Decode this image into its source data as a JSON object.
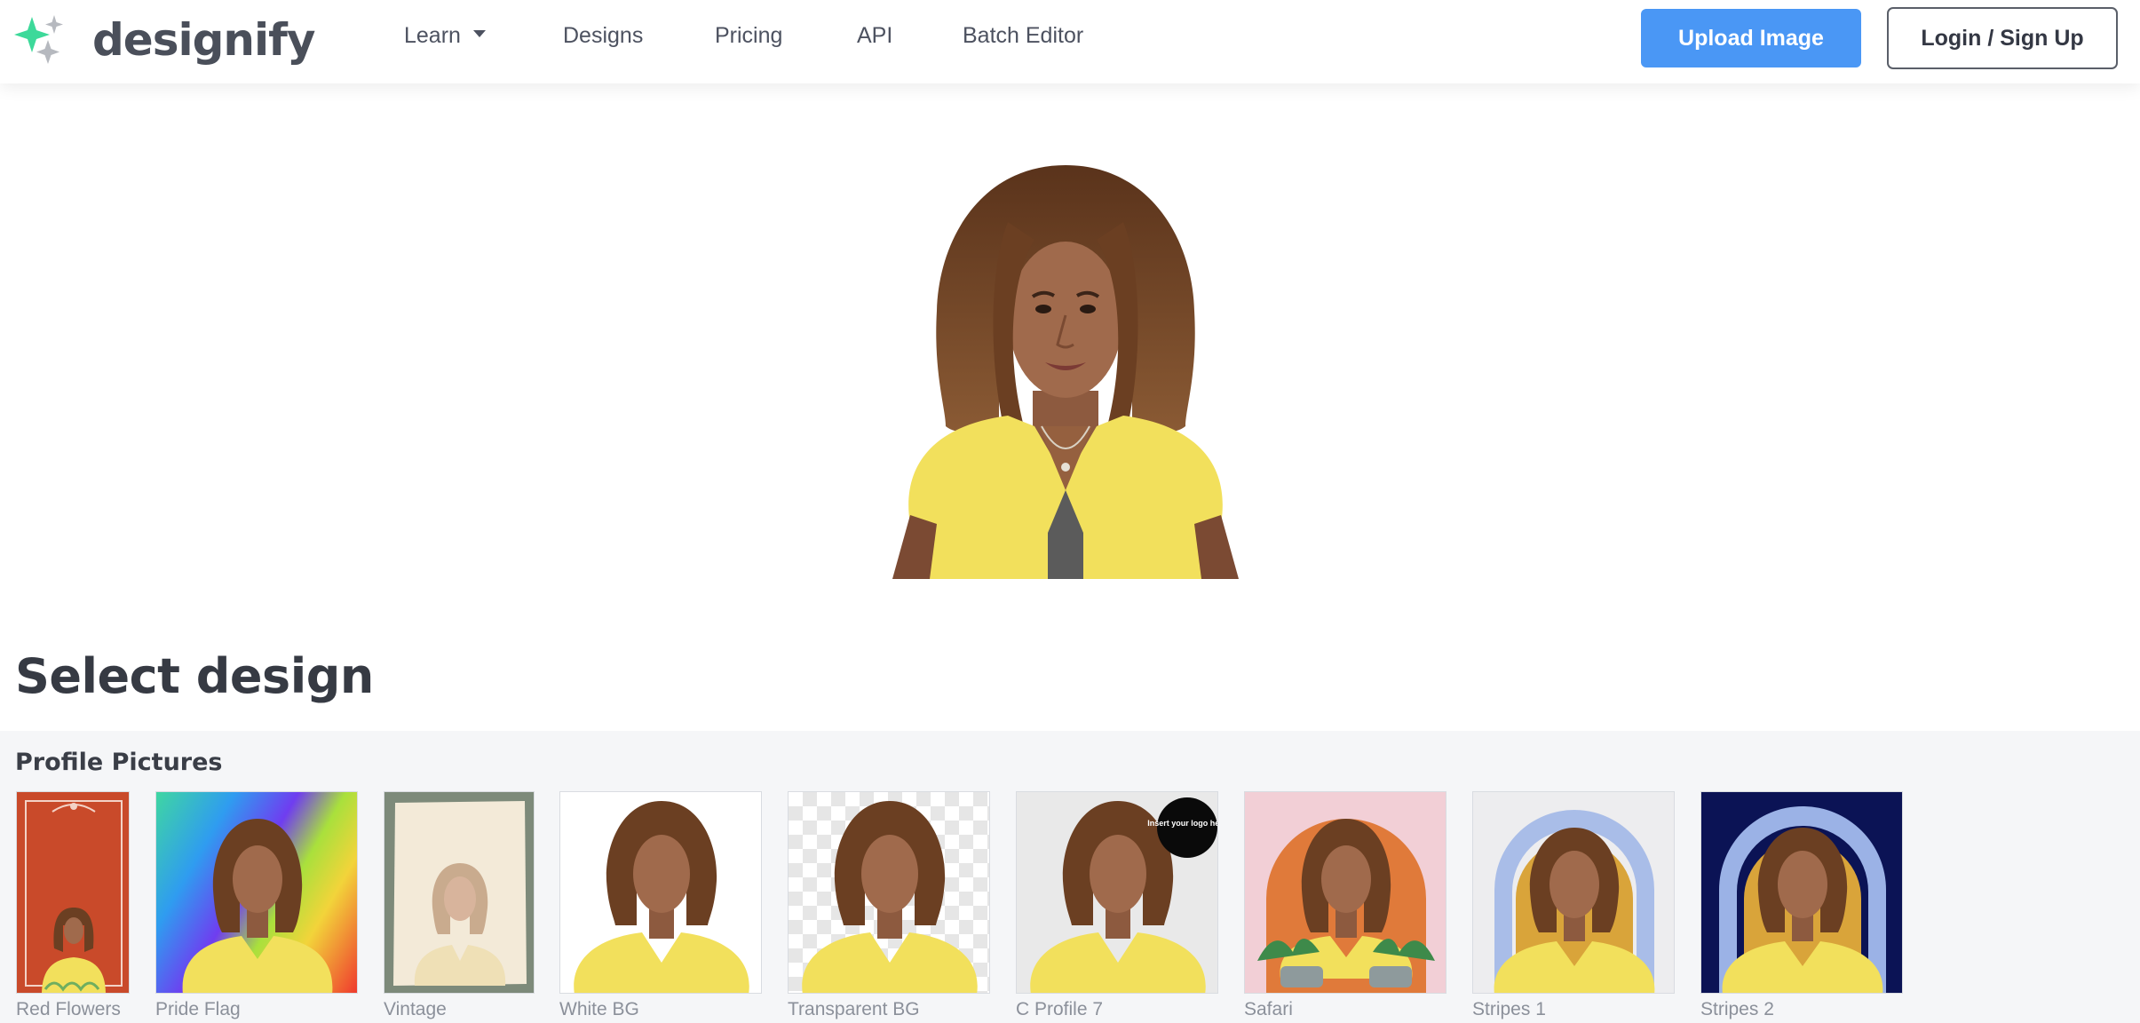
{
  "brand": {
    "name": "designify"
  },
  "nav": {
    "learn": "Learn",
    "designs": "Designs",
    "pricing": "Pricing",
    "api": "API",
    "batch_editor": "Batch Editor"
  },
  "actions": {
    "upload": "Upload Image",
    "login": "Login / Sign Up"
  },
  "main": {
    "select_title": "Select design",
    "section_title": "Profile Pictures"
  },
  "designs": [
    {
      "label": "Red Flowers",
      "bg": "#c94a2a"
    },
    {
      "label": "Pride Flag",
      "bg": "gradient-rainbow"
    },
    {
      "label": "Vintage",
      "bg": "#7d8a7a"
    },
    {
      "label": "White BG",
      "bg": "#ffffff"
    },
    {
      "label": "Transparent BG",
      "bg": "checkerboard"
    },
    {
      "label": "C Profile 7",
      "bg": "#e9e9e9",
      "badge": "Insert your logo here"
    },
    {
      "label": "Safari",
      "bg": "#f2cfd6"
    },
    {
      "label": "Stripes 1",
      "bg": "#ededef"
    },
    {
      "label": "Stripes 2",
      "bg": "#0b1355"
    }
  ],
  "colors": {
    "accent": "#4a97f5",
    "logo_green": "#3dd99a",
    "logo_gray": "#b6b9bf",
    "shirt_yellow": "#f2e05c",
    "hair": "#6b3f22",
    "skin": "#9a6548"
  }
}
